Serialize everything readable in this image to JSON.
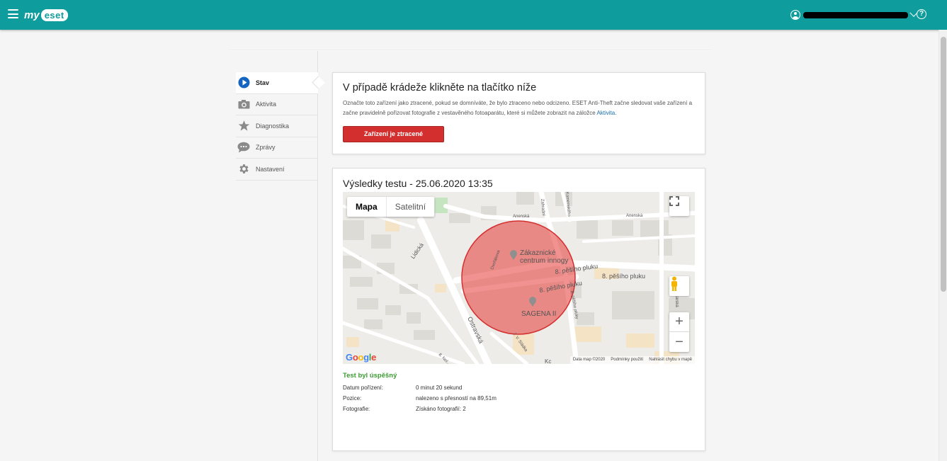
{
  "header": {
    "logo_my": "my",
    "logo_eset": "eset",
    "help_symbol": "?",
    "brand_color": "#0e9c9c"
  },
  "sidebar": {
    "items": [
      {
        "label": "Stav",
        "icon": "play-circle-icon",
        "active": true
      },
      {
        "label": "Aktivita",
        "icon": "camera-icon",
        "active": false
      },
      {
        "label": "Diagnostika",
        "icon": "star-icon",
        "active": false
      },
      {
        "label": "Zprávy",
        "icon": "chat-bubble-icon",
        "active": false
      },
      {
        "label": "Nastavení",
        "icon": "gear-icon",
        "active": false
      }
    ]
  },
  "theft_card": {
    "title": "V případě krádeže klikněte na tlačítko níže",
    "text": "Označte toto zařízení jako ztracené, pokud se domníváte, že bylo ztraceno nebo odcizeno. ESET Anti-Theft začne sledovat vaše zařízení a začne pravidelně pořizovat fotografie z vestavěného fotoaparátu, které si můžete zobrazit na záložce ",
    "link_text": "Aktivita",
    "text_end": ".",
    "button_label": "Zařízení je ztracené",
    "button_color": "#d32f2f"
  },
  "test_card": {
    "title": "Výsledky testu - 25.06.2020 13:35",
    "map": {
      "tabs": [
        "Mapa",
        "Satelitní"
      ],
      "active_tab": "Mapa",
      "labels": {
        "poi1_line1": "Zákaznické",
        "poi1_line2": "centrum innogy",
        "poi2": "SAGENA II",
        "street1": "8. pěšího pluku",
        "street2": "8. pěšího pluku",
        "street3": "8. pěšího pluku",
        "street4": "Anenská",
        "street5": "Anenská",
        "street6": "Lidická",
        "street7": "Ostravská",
        "street8": "Dvořákova",
        "street9": "J. V. Sládka",
        "street10": "Zahradní",
        "street11": "Komenského",
        "street12": "8. Nel...",
        "street13": "Kc",
        "street14": "xarská",
        "street15": "8. pěšího pluky"
      },
      "zoom_in": "+",
      "zoom_out": "−",
      "google_logo": "Google",
      "footer": [
        "Data map ©2020",
        "Podmínky použití",
        "Nahlásit chybu v mapě"
      ],
      "accuracy_circle_color": "#e53935"
    },
    "result_title": "Test byl úspěšný",
    "result_color": "#3e9c35",
    "rows": [
      {
        "label": "Datum pořízení:",
        "value": "0 minut 20 sekund"
      },
      {
        "label": "Pozice:",
        "value": "nalezeno s přesností na 89,51m"
      },
      {
        "label": "Fotografie:",
        "value": "Získáno fotografií: 2"
      }
    ]
  }
}
